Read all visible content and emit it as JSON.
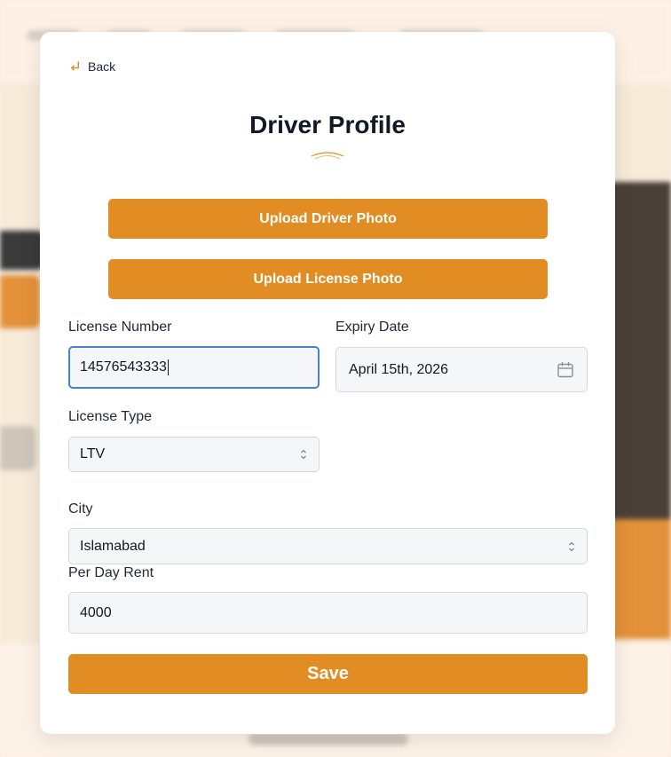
{
  "back": {
    "label": "Back",
    "icon": "arrow-return-icon"
  },
  "page": {
    "title": "Driver Profile"
  },
  "uploads": {
    "driver_photo_label": "Upload Driver Photo",
    "license_photo_label": "Upload License Photo"
  },
  "form": {
    "license_number": {
      "label": "License Number",
      "value": "14576543333"
    },
    "expiry_date": {
      "label": "Expiry Date",
      "value": "April 15th, 2026",
      "icon": "calendar-icon"
    },
    "license_type": {
      "label": "License Type",
      "value": "LTV"
    },
    "city": {
      "label": "City",
      "value": "Islamabad"
    },
    "per_day_rent": {
      "label": "Per Day Rent",
      "value": "4000"
    }
  },
  "save_label": "Save",
  "colors": {
    "accent": "#e28c24",
    "focus_border": "#4a80cc",
    "backdrop": "#fbeee3"
  }
}
